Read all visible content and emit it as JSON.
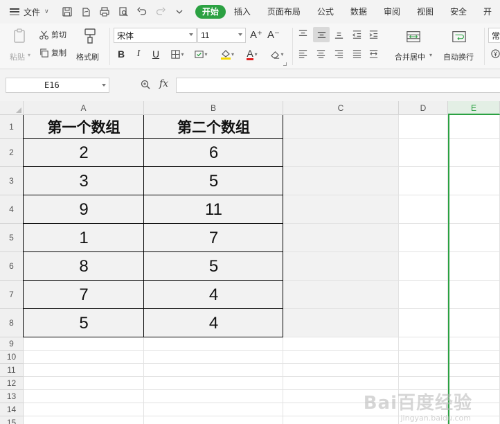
{
  "menu": {
    "file_label": "文件",
    "tabs": [
      "开始",
      "插入",
      "页面布局",
      "公式",
      "数据",
      "审阅",
      "视图",
      "安全",
      "开"
    ],
    "active_tab": "开始"
  },
  "ribbon": {
    "paste_label": "粘贴",
    "cut_label": "剪切",
    "copy_label": "复制",
    "format_painter_label": "格式刷",
    "font_name": "宋体",
    "font_size": "11",
    "bold": "B",
    "italic": "I",
    "underline": "U",
    "font_color_glyph": "A",
    "grow_font": "A⁺",
    "shrink_font": "A⁻",
    "merge_center_label": "合并居中",
    "wrap_text_label": "自动换行",
    "style_label": "常",
    "accent_color": "#2ba142",
    "font_color": "#e02020",
    "fill_color": "#f5d800"
  },
  "formula_bar": {
    "name_box": "E16",
    "fx_label": "fx",
    "formula": ""
  },
  "sheet": {
    "columns": [
      "A",
      "B",
      "C",
      "D",
      "E"
    ],
    "selected_column": "E",
    "rows": [
      "1",
      "2",
      "3",
      "4",
      "5",
      "6",
      "7",
      "8",
      "9",
      "10",
      "11",
      "12",
      "13",
      "14",
      "15"
    ],
    "table": {
      "headers": [
        "第一个数组",
        "第二个数组"
      ],
      "values": [
        [
          "2",
          "6"
        ],
        [
          "3",
          "5"
        ],
        [
          "9",
          "11"
        ],
        [
          "1",
          "7"
        ],
        [
          "8",
          "5"
        ],
        [
          "7",
          "4"
        ],
        [
          "5",
          "4"
        ]
      ]
    }
  },
  "watermark": {
    "logo_text": "Bai百度经验",
    "url_text": "jingyan.baidu.com"
  }
}
